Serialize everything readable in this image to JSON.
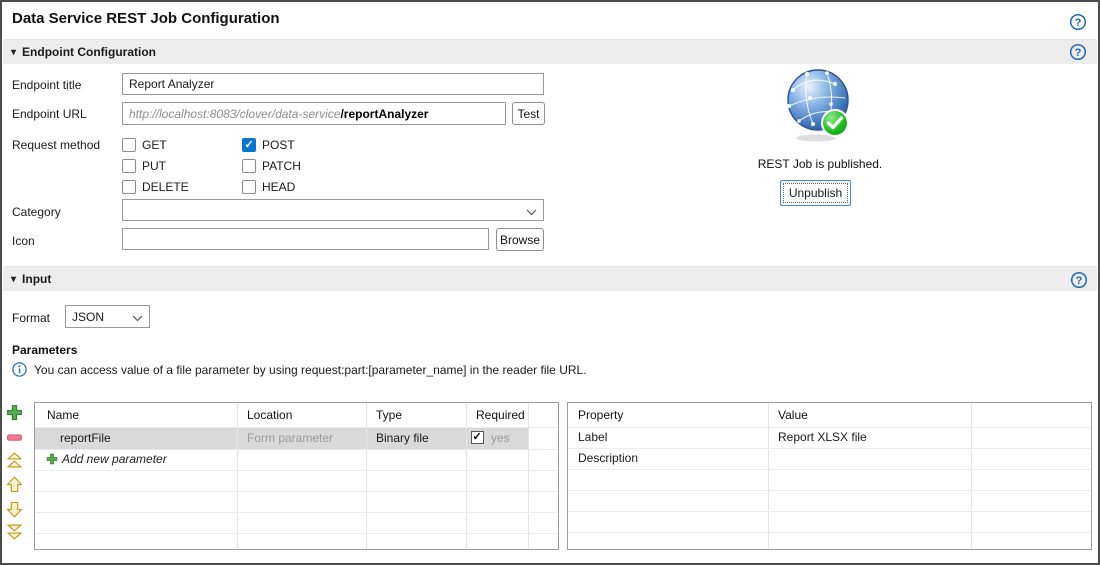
{
  "title": "Data Service REST Job Configuration",
  "colors": {
    "accent_blue": "#0b76d1",
    "help_blue": "#2267b5",
    "selected_row": "#d9d9d9",
    "section_band": "#ededed",
    "add_green": "#3c9e3c",
    "remove_pink": "#f0798f",
    "move_gold": "#c49a1f",
    "published_green": "#22c022"
  },
  "icons": {
    "help": "question-mark-circle",
    "collapse": "▾",
    "chevron_down": "⌄",
    "add": "green-plus",
    "remove": "pink-minus",
    "move_top": "double-chevron-up",
    "move_up": "arrow-up",
    "move_down": "arrow-down",
    "move_bottom": "double-chevron-down",
    "info": "info-circle",
    "published": "globe-with-green-checkmark"
  },
  "endpoint": {
    "section_title": "Endpoint Configuration",
    "endpoint_title": {
      "label": "Endpoint title",
      "value": "Report Analyzer"
    },
    "endpoint_url": {
      "label": "Endpoint URL",
      "base": "http://localhost:8083/clover/data-service",
      "path": "/reportAnalyzer",
      "test_button": "Test"
    },
    "request_method": {
      "label": "Request method",
      "options": [
        {
          "label": "GET",
          "checked": false
        },
        {
          "label": "POST",
          "checked": true
        },
        {
          "label": "PUT",
          "checked": false
        },
        {
          "label": "PATCH",
          "checked": false
        },
        {
          "label": "DELETE",
          "checked": false
        },
        {
          "label": "HEAD",
          "checked": false
        }
      ]
    },
    "category": {
      "label": "Category",
      "value": ""
    },
    "icon": {
      "label": "Icon",
      "value": "",
      "browse_button": "Browse"
    },
    "publish": {
      "status": "REST Job is published.",
      "button": "Unpublish"
    }
  },
  "input": {
    "section_title": "Input",
    "format": {
      "label": "Format",
      "value": "JSON"
    },
    "parameters_heading": "Parameters",
    "info_text": "You can access value of a file parameter by using request:part:[parameter_name] in the reader file URL.",
    "param_table": {
      "columns": [
        "Name",
        "Location",
        "Type",
        "Required"
      ],
      "rows": [
        {
          "name": "reportFile",
          "location": "Form parameter",
          "type": "Binary file",
          "required": true,
          "required_label": "yes"
        }
      ],
      "add_row_label": "Add new parameter"
    },
    "property_table": {
      "columns": [
        "Property",
        "Value"
      ],
      "rows": [
        {
          "property": "Label",
          "value": "Report XLSX file"
        },
        {
          "property": "Description",
          "value": ""
        }
      ]
    }
  }
}
